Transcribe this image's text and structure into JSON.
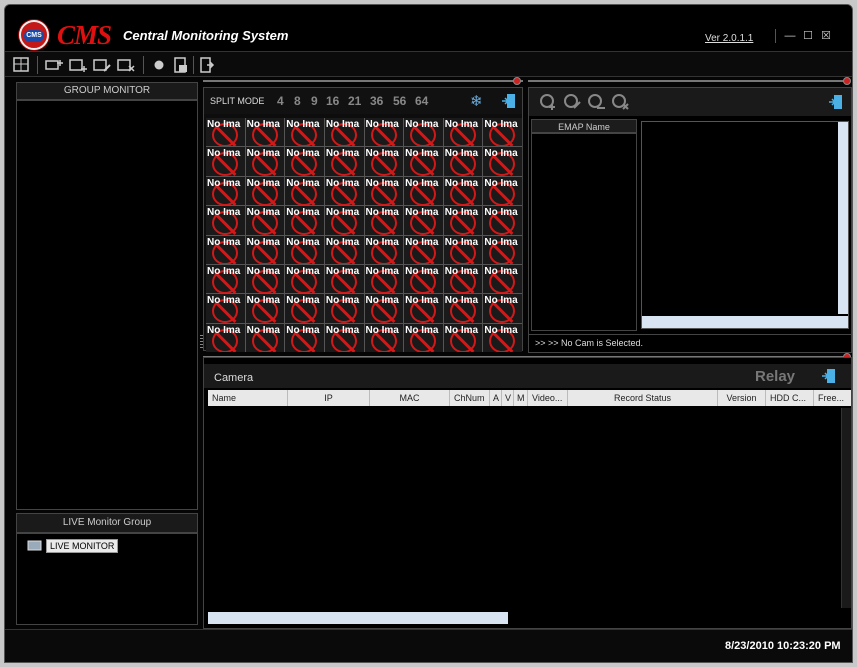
{
  "app": {
    "brand": "CMS",
    "subtitle": "Central Monitoring System",
    "logo_text": "CMS",
    "version": "Ver 2.0.1.1",
    "window_controls": [
      "minimize-icon",
      "maximize-icon",
      "close-icon"
    ]
  },
  "toolbar": {
    "icons": [
      "layout-icon",
      "add-device-icon",
      "add-group-icon",
      "edit-group-icon",
      "delete-group-icon",
      "record-icon",
      "playback-icon",
      "exit-icon"
    ]
  },
  "left": {
    "group_monitor_title": "GROUP MONITOR",
    "live_group_title": "LIVE Monitor Group",
    "live_node_label": "LIVE MONITOR"
  },
  "split": {
    "title": "SPLIT MODE",
    "modes": [
      "4",
      "8",
      "9",
      "16",
      "21",
      "36",
      "56",
      "64"
    ],
    "cell_text": "No Ima",
    "rows": 8,
    "cols": 8
  },
  "emap": {
    "header": "EMAP Name",
    "status": ">> >> No Cam is Selected.",
    "icons": [
      "emap-add-icon",
      "emap-edit-icon",
      "emap-link-icon",
      "emap-delete-icon"
    ]
  },
  "camera": {
    "title": "Camera",
    "relay_label": "Relay",
    "columns": [
      "Name",
      "IP",
      "MAC",
      "ChNum",
      "A",
      "V",
      "M",
      "Video...",
      "Record Status",
      "Version",
      "HDD C...",
      "Free..."
    ]
  },
  "footer": {
    "datetime": "8/23/2010 10:23:20 PM"
  },
  "colors": {
    "accent_red": "#e01010",
    "background": "#050505",
    "scrollbar": "#d9e4f2"
  }
}
